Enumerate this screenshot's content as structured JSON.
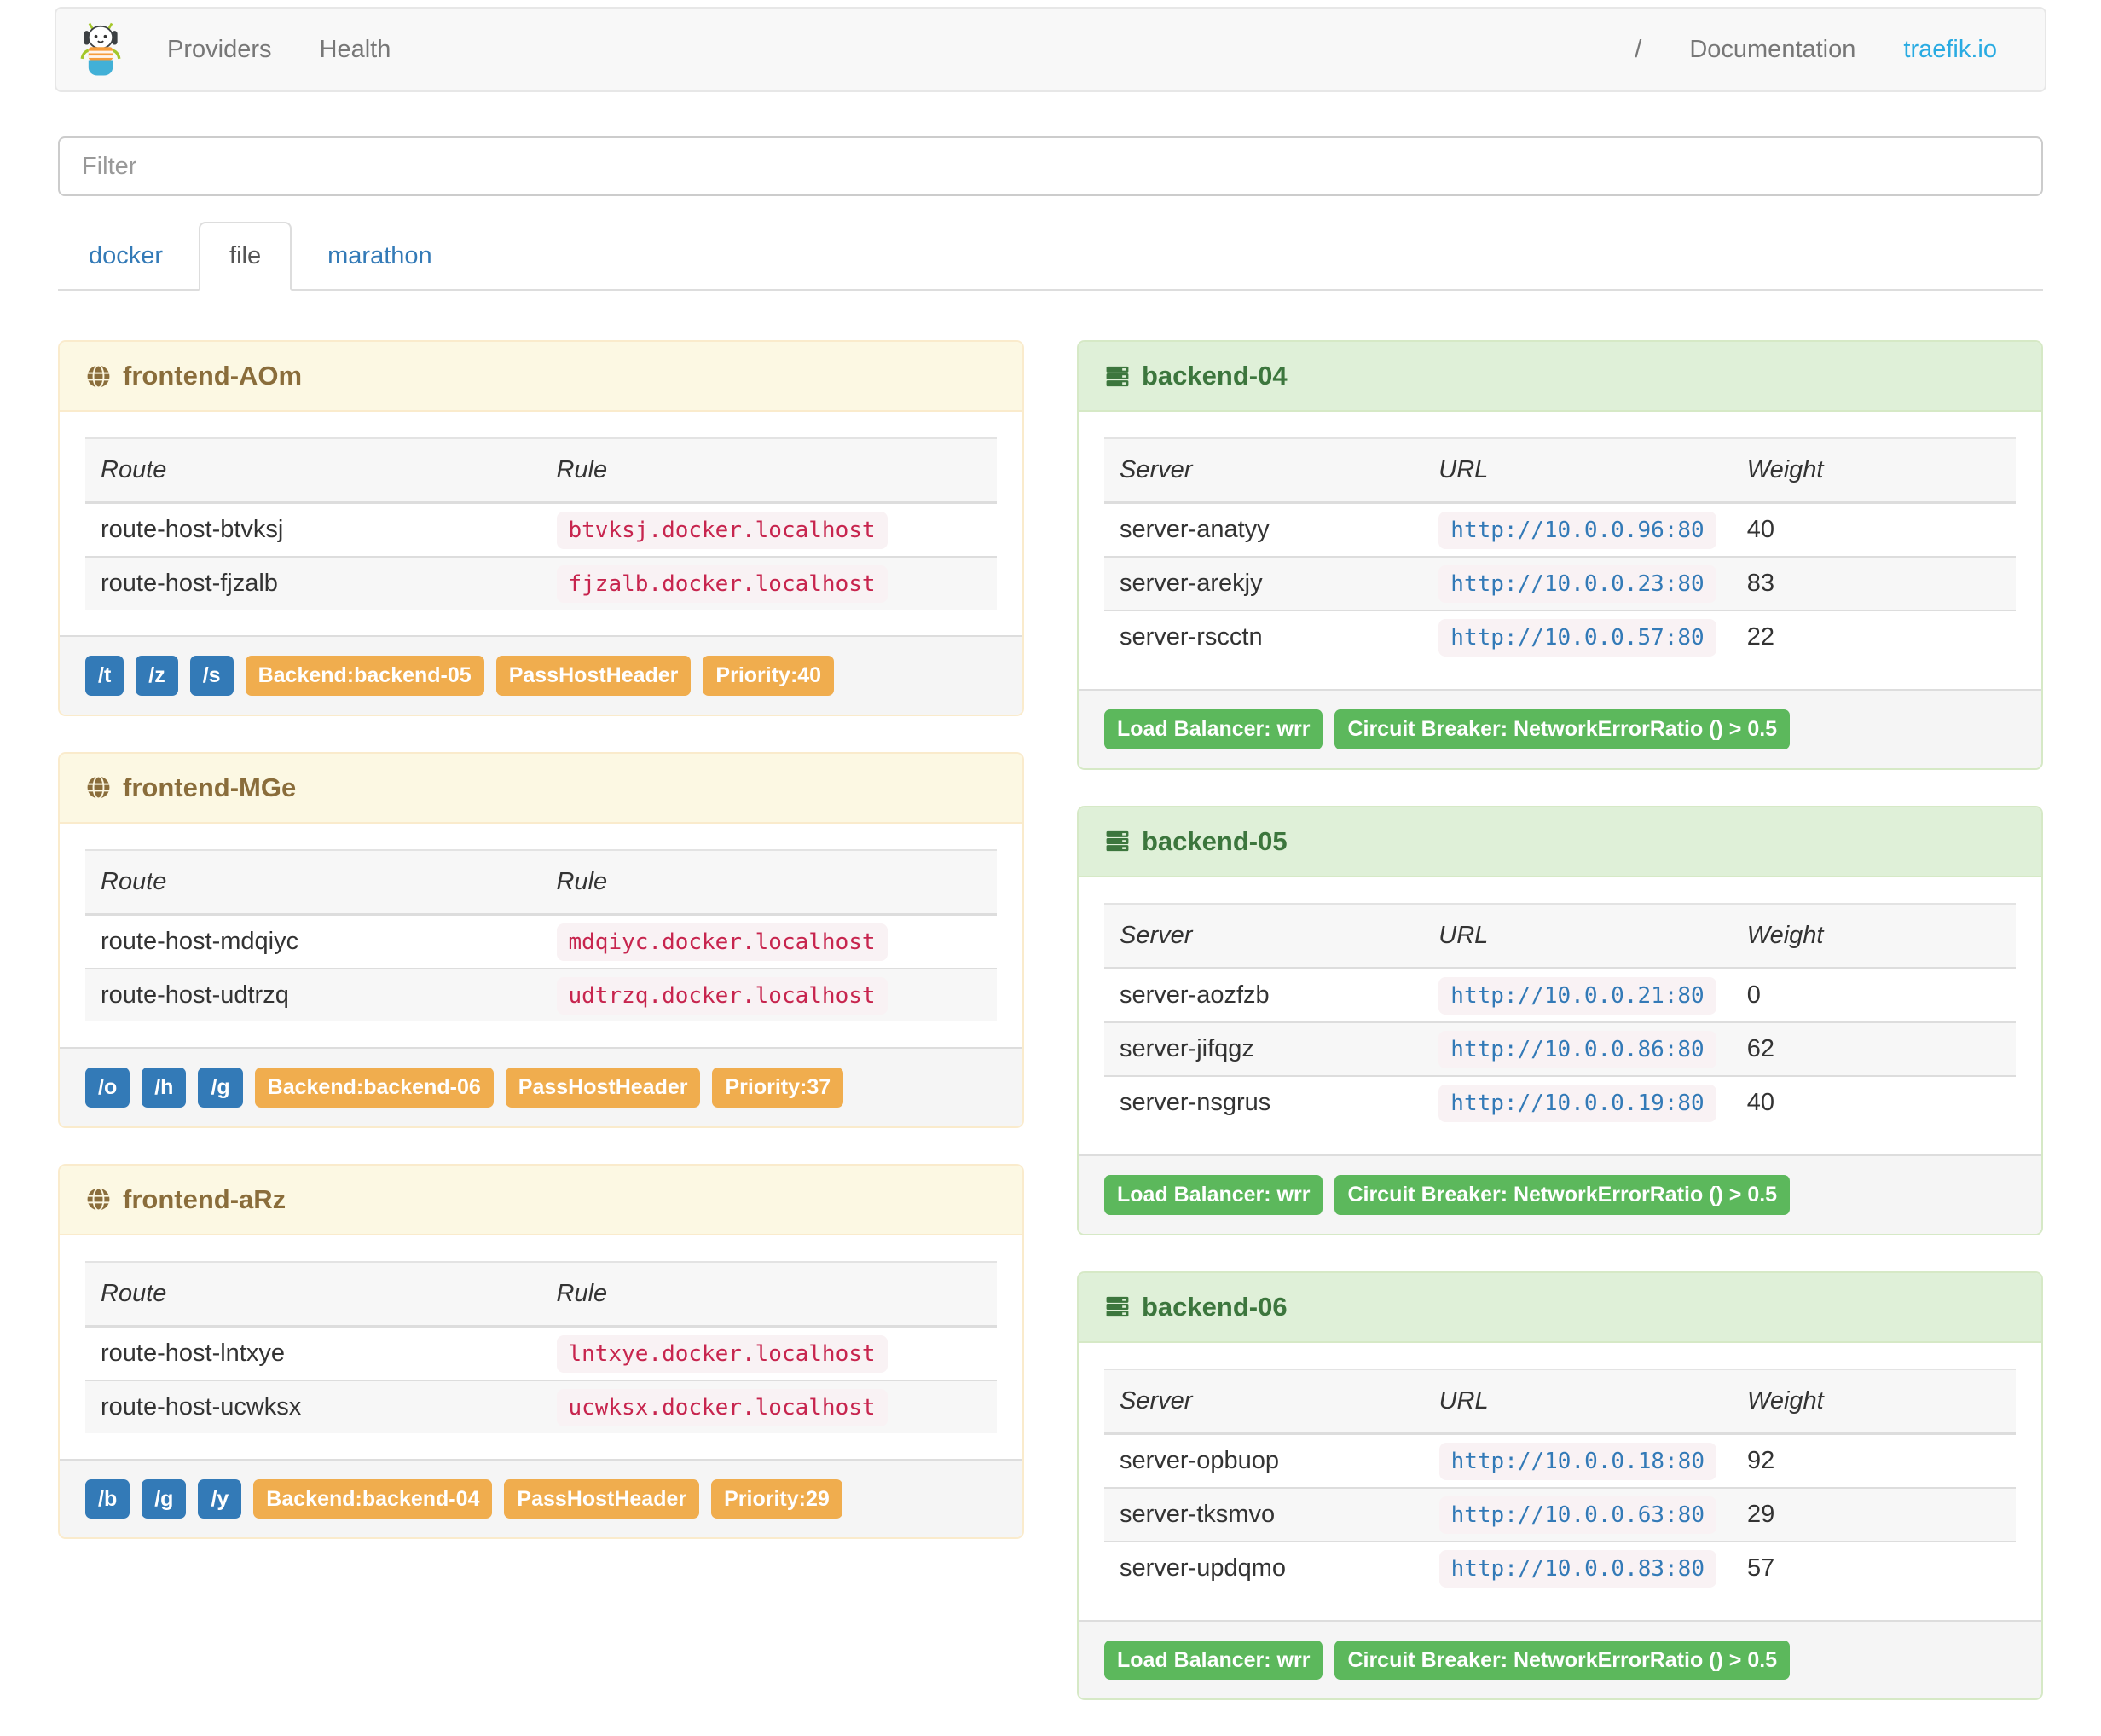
{
  "navbar": {
    "brand_icon": "traefik-logo",
    "providers": "Providers",
    "health": "Health",
    "separator": "/",
    "documentation": "Documentation",
    "site": "traefik.io"
  },
  "filter": {
    "placeholder": "Filter",
    "value": ""
  },
  "tabs": [
    {
      "label": "docker",
      "active": false
    },
    {
      "label": "file",
      "active": true
    },
    {
      "label": "marathon",
      "active": false
    }
  ],
  "frontends": [
    {
      "icon": "globe-icon",
      "title": "frontend-AOm",
      "columns": [
        "Route",
        "Rule"
      ],
      "rows": [
        {
          "route": "route-host-btvksj",
          "rule": "btvksj.docker.localhost"
        },
        {
          "route": "route-host-fjzalb",
          "rule": "fjzalb.docker.localhost"
        }
      ],
      "route_badges": [
        "/t",
        "/z",
        "/s"
      ],
      "detail_badges": [
        "Backend:backend-05",
        "PassHostHeader",
        "Priority:40"
      ]
    },
    {
      "icon": "globe-icon",
      "title": "frontend-MGe",
      "columns": [
        "Route",
        "Rule"
      ],
      "rows": [
        {
          "route": "route-host-mdqiyc",
          "rule": "mdqiyc.docker.localhost"
        },
        {
          "route": "route-host-udtrzq",
          "rule": "udtrzq.docker.localhost"
        }
      ],
      "route_badges": [
        "/o",
        "/h",
        "/g"
      ],
      "detail_badges": [
        "Backend:backend-06",
        "PassHostHeader",
        "Priority:37"
      ]
    },
    {
      "icon": "globe-icon",
      "title": "frontend-aRz",
      "columns": [
        "Route",
        "Rule"
      ],
      "rows": [
        {
          "route": "route-host-lntxye",
          "rule": "lntxye.docker.localhost"
        },
        {
          "route": "route-host-ucwksx",
          "rule": "ucwksx.docker.localhost"
        }
      ],
      "route_badges": [
        "/b",
        "/g",
        "/y"
      ],
      "detail_badges": [
        "Backend:backend-04",
        "PassHostHeader",
        "Priority:29"
      ]
    }
  ],
  "backends": [
    {
      "icon": "server-icon",
      "title": "backend-04",
      "columns": [
        "Server",
        "URL",
        "Weight"
      ],
      "rows": [
        {
          "server": "server-anatyy",
          "url": "http://10.0.0.96:80",
          "weight": "40"
        },
        {
          "server": "server-arekjy",
          "url": "http://10.0.0.23:80",
          "weight": "83"
        },
        {
          "server": "server-rscctn",
          "url": "http://10.0.0.57:80",
          "weight": "22"
        }
      ],
      "badges": [
        "Load Balancer: wrr",
        "Circuit Breaker: NetworkErrorRatio () > 0.5"
      ]
    },
    {
      "icon": "server-icon",
      "title": "backend-05",
      "columns": [
        "Server",
        "URL",
        "Weight"
      ],
      "rows": [
        {
          "server": "server-aozfzb",
          "url": "http://10.0.0.21:80",
          "weight": "0"
        },
        {
          "server": "server-jifqgz",
          "url": "http://10.0.0.86:80",
          "weight": "62"
        },
        {
          "server": "server-nsgrus",
          "url": "http://10.0.0.19:80",
          "weight": "40"
        }
      ],
      "badges": [
        "Load Balancer: wrr",
        "Circuit Breaker: NetworkErrorRatio () > 0.5"
      ]
    },
    {
      "icon": "server-icon",
      "title": "backend-06",
      "columns": [
        "Server",
        "URL",
        "Weight"
      ],
      "rows": [
        {
          "server": "server-opbuop",
          "url": "http://10.0.0.18:80",
          "weight": "92"
        },
        {
          "server": "server-tksmvo",
          "url": "http://10.0.0.63:80",
          "weight": "29"
        },
        {
          "server": "server-updqmo",
          "url": "http://10.0.0.83:80",
          "weight": "57"
        }
      ],
      "badges": [
        "Load Balancer: wrr",
        "Circuit Breaker: NetworkErrorRatio () > 0.5"
      ]
    }
  ],
  "colors": {
    "primary_blue": "#337ab7",
    "warning_orange": "#f0ad4e",
    "success_green": "#5cb85c",
    "code_pink_text": "#c7254e",
    "code_pink_bg": "#f9f2f4",
    "frontend_header_bg": "#fcf8e3",
    "frontend_header_text": "#8a6d3b",
    "frontend_border": "#faebcc",
    "backend_header_bg": "#dff0d8",
    "backend_header_text": "#3c763d",
    "backend_border": "#d6e9c6",
    "brand_link_blue": "#29abe2"
  }
}
